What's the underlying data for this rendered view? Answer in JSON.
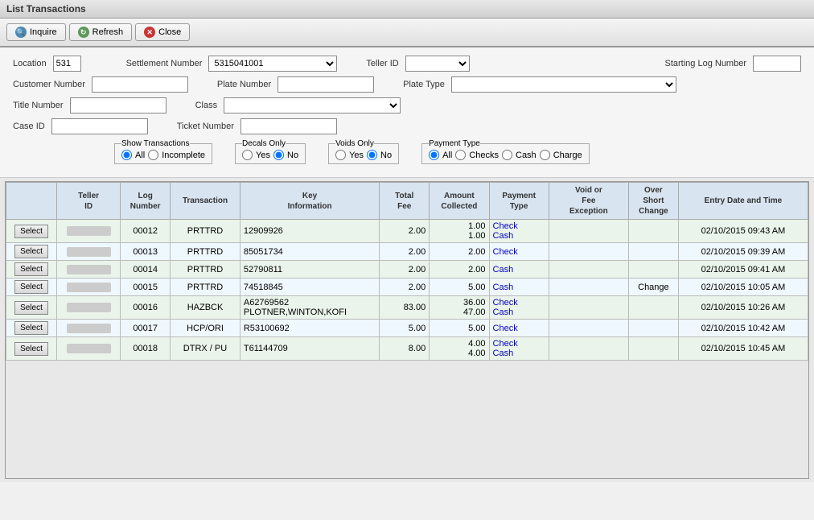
{
  "title": "List Transactions",
  "toolbar": {
    "inquire_label": "Inquire",
    "refresh_label": "Refresh",
    "close_label": "Close"
  },
  "form": {
    "location_label": "Location",
    "location_value": "531",
    "settlement_number_label": "Settlement Number",
    "settlement_number_value": "5315041001",
    "teller_id_label": "Teller ID",
    "starting_log_label": "Starting Log Number",
    "customer_number_label": "Customer Number",
    "plate_number_label": "Plate Number",
    "plate_type_label": "Plate Type",
    "title_number_label": "Title Number",
    "class_label": "Class",
    "case_id_label": "Case ID",
    "ticket_number_label": "Ticket Number",
    "show_transactions_legend": "Show Transactions",
    "show_all_label": "All",
    "show_incomplete_label": "Incomplete",
    "decals_only_legend": "Decals Only",
    "decals_yes_label": "Yes",
    "decals_no_label": "No",
    "voids_only_legend": "Voids Only",
    "voids_yes_label": "Yes",
    "voids_no_label": "No",
    "payment_type_legend": "Payment Type",
    "payment_all_label": "All",
    "payment_checks_label": "Checks",
    "payment_cash_label": "Cash",
    "payment_charge_label": "Charge"
  },
  "table": {
    "headers": [
      "",
      "Teller ID",
      "Log Number",
      "Transaction",
      "Key Information",
      "Total Fee",
      "Amount Collected",
      "Payment Type",
      "Void or Fee Exception",
      "Over Short Change",
      "Entry Date and Time"
    ],
    "rows": [
      {
        "select": "Select",
        "teller_id": "REDACTED",
        "log_number": "00012",
        "transaction": "PRTTRD",
        "key_info": "12909926",
        "total_fee": "2.00",
        "amount_collected": "1.00\n1.00",
        "payment_type": "Check\nCash",
        "void_fee": "",
        "over_short": "",
        "entry_date": "02/10/2015",
        "entry_time": "09:43 AM"
      },
      {
        "select": "Select",
        "teller_id": "REDACTED",
        "log_number": "00013",
        "transaction": "PRTTRD",
        "key_info": "85051734",
        "total_fee": "2.00",
        "amount_collected": "2.00",
        "payment_type": "Check",
        "void_fee": "",
        "over_short": "",
        "entry_date": "02/10/2015",
        "entry_time": "09:39 AM"
      },
      {
        "select": "Select",
        "teller_id": "REDACTED",
        "log_number": "00014",
        "transaction": "PRTTRD",
        "key_info": "52790811",
        "total_fee": "2.00",
        "amount_collected": "2.00",
        "payment_type": "Cash",
        "void_fee": "",
        "over_short": "",
        "entry_date": "02/10/2015",
        "entry_time": "09:41 AM"
      },
      {
        "select": "Select",
        "teller_id": "REDACTED",
        "log_number": "00015",
        "transaction": "PRTTRD",
        "key_info": "74518845",
        "total_fee": "2.00",
        "amount_collected": "5.00",
        "payment_type": "Cash",
        "void_fee": "",
        "over_short": "Change",
        "entry_date": "02/10/2015",
        "entry_time": "10:05 AM"
      },
      {
        "select": "Select",
        "teller_id": "REDACTED",
        "log_number": "00016",
        "transaction": "HAZBCK",
        "key_info": "A62769562\nPLOTNER,WINTON,KOFI",
        "total_fee": "83.00",
        "amount_collected": "36.00\n47.00",
        "payment_type": "Check\nCash",
        "void_fee": "",
        "over_short": "",
        "entry_date": "02/10/2015",
        "entry_time": "10:26 AM"
      },
      {
        "select": "Select",
        "teller_id": "REDACTED",
        "log_number": "00017",
        "transaction": "HCP/ORI",
        "key_info": "R53100692",
        "total_fee": "5.00",
        "amount_collected": "5.00",
        "payment_type": "Check",
        "void_fee": "",
        "over_short": "",
        "entry_date": "02/10/2015",
        "entry_time": "10:42 AM"
      },
      {
        "select": "Select",
        "teller_id": "REDACTED",
        "log_number": "00018",
        "transaction": "DTRX / PU",
        "key_info": "T61144709",
        "total_fee": "8.00",
        "amount_collected": "4.00\n4.00",
        "payment_type": "Check\nCash",
        "void_fee": "",
        "over_short": "",
        "entry_date": "02/10/2015",
        "entry_time": "10:45 AM"
      }
    ]
  }
}
